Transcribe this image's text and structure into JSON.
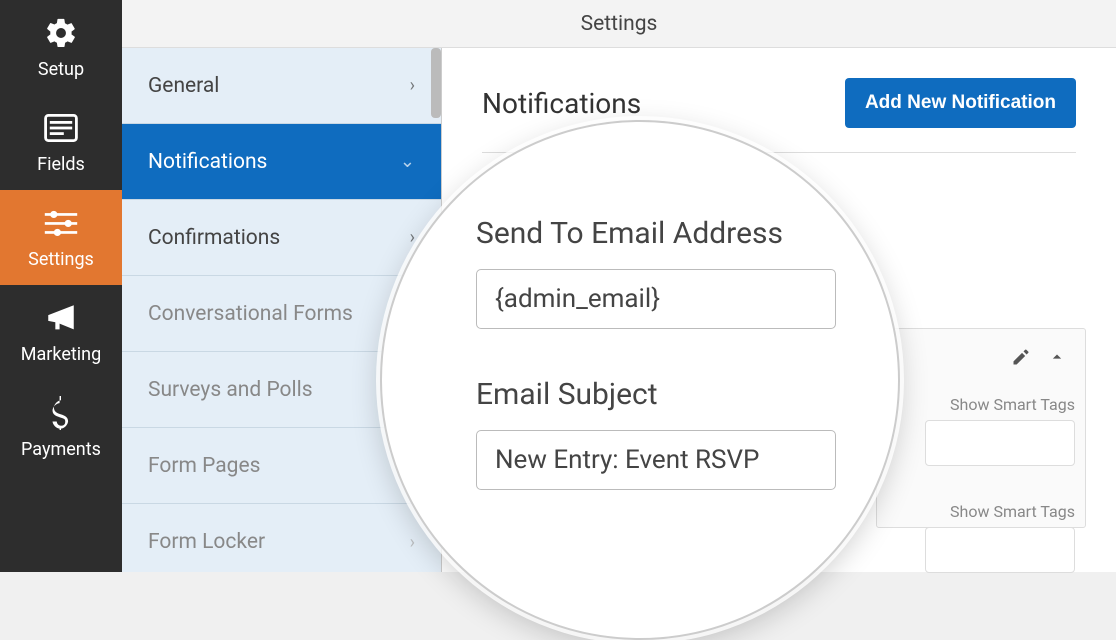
{
  "topbar": {
    "title": "Settings"
  },
  "nav": {
    "items": [
      {
        "label": "Setup"
      },
      {
        "label": "Fields"
      },
      {
        "label": "Settings"
      },
      {
        "label": "Marketing"
      },
      {
        "label": "Payments"
      }
    ]
  },
  "subnav": {
    "items": [
      {
        "label": "General"
      },
      {
        "label": "Notifications"
      },
      {
        "label": "Confirmations"
      },
      {
        "label": "Conversational Forms"
      },
      {
        "label": "Surveys and Polls"
      },
      {
        "label": "Form Pages"
      },
      {
        "label": "Form Locker"
      }
    ]
  },
  "main": {
    "title": "Notifications",
    "add_button": "Add New Notification",
    "smart_tags_label": "Show Smart Tags"
  },
  "magnify": {
    "send_to_label": "Send To Email Address",
    "send_to_value": "{admin_email}",
    "subject_label": "Email Subject",
    "subject_value": "New Entry: Event RSVP"
  },
  "colors": {
    "accent_orange": "#e27730",
    "accent_blue": "#0F6CBF",
    "dark_nav": "#2d2d2d",
    "light_subnav": "#e4eef7"
  }
}
